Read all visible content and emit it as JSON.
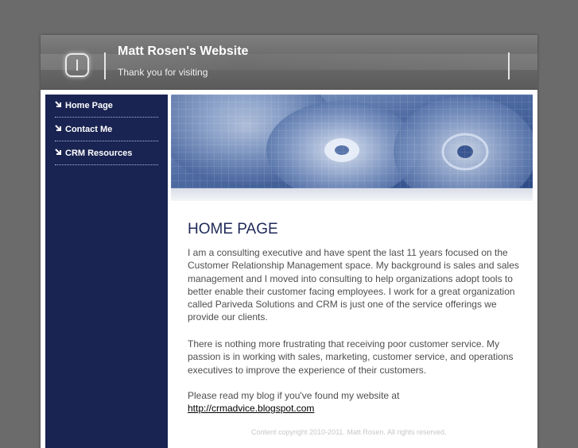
{
  "header": {
    "title": "Matt Rosen's Website",
    "tagline": "Thank you for visiting"
  },
  "nav": {
    "items": [
      {
        "label": "Home Page"
      },
      {
        "label": "Contact Me"
      },
      {
        "label": "CRM Resources"
      }
    ]
  },
  "main": {
    "heading": "HOME PAGE",
    "paragraph1": "I am a consulting executive and have spent the last 11 years focused on the Customer Relationship Management space. My background is sales and sales management and I moved into consulting to help organizations adopt tools to better enable their customer facing employees. I work for a great organization called Pariveda Solutions and CRM is just one of the service offerings we provide our clients.",
    "paragraph2": "There is nothing more frustrating that receiving poor customer service.  My passion is in working with sales, marketing, customer service, and operations executives to improve the experience of their customers.",
    "paragraph3": "Please read my blog if you've found my website at",
    "blog_link": "http://crmadvice.blogspot.com"
  },
  "footer": {
    "text": "Content copyright 2010-2011. Matt Rosen. All rights reserved."
  },
  "colors": {
    "sidebar": "#1a2452",
    "heading": "#1f2a58",
    "background": "#6b6b6b"
  }
}
